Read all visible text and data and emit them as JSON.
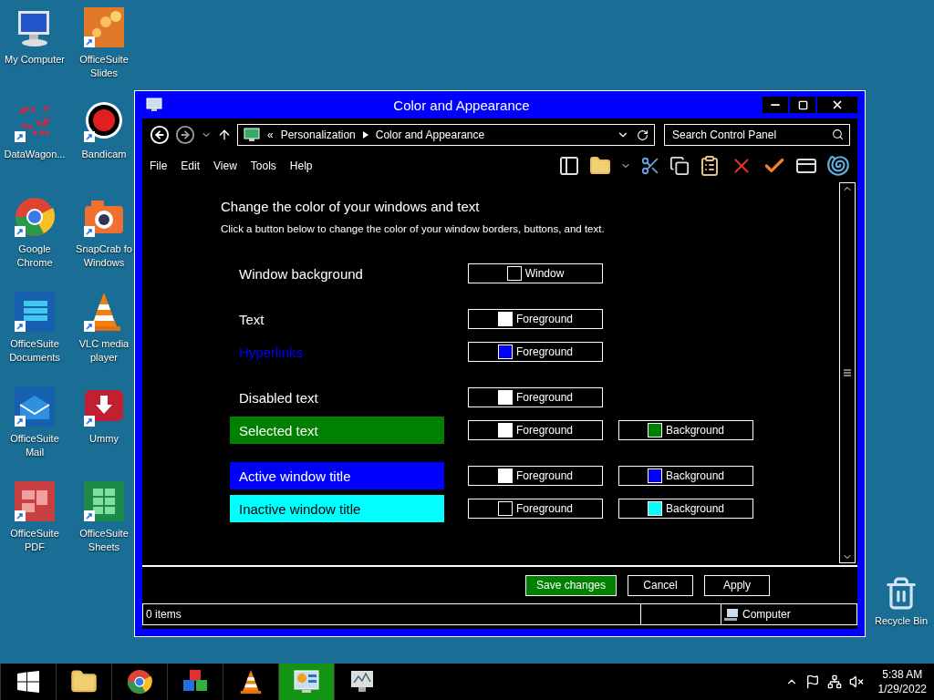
{
  "desktop_icons": [
    {
      "label": "My Computer",
      "kind": "computer",
      "shortcut": false
    },
    {
      "label": "OfficeSuite\nSlides",
      "kind": "slides",
      "shortcut": true
    },
    {
      "label": "DataWagon...",
      "kind": "network",
      "shortcut": true
    },
    {
      "label": "Bandicam",
      "kind": "record",
      "shortcut": true
    },
    {
      "label": "Google\nChrome",
      "kind": "chrome",
      "shortcut": true
    },
    {
      "label": "SnapCrab fo\nWindows",
      "kind": "camera",
      "shortcut": true
    },
    {
      "label": "OfficeSuite\nDocuments",
      "kind": "documents",
      "shortcut": true
    },
    {
      "label": "VLC media\nplayer",
      "kind": "cone",
      "shortcut": true
    },
    {
      "label": "OfficeSuite\nMail",
      "kind": "mail",
      "shortcut": true
    },
    {
      "label": "Ummy",
      "kind": "download",
      "shortcut": true
    },
    {
      "label": "OfficeSuite\nPDF",
      "kind": "pdf",
      "shortcut": true
    },
    {
      "label": "OfficeSuite\nSheets",
      "kind": "sheets",
      "shortcut": true
    }
  ],
  "recycle_bin": {
    "label": "Recycle Bin"
  },
  "window": {
    "title": "Color and Appearance",
    "breadcrumb": [
      "«",
      "Personalization",
      "Color and Appearance"
    ],
    "search": {
      "placeholder": "Search Control Panel"
    },
    "menu": [
      "File",
      "Edit",
      "View",
      "Tools",
      "Help"
    ],
    "heading": "Change the color of your windows and text",
    "subtitle": "Click a button below to change the color of your window borders, buttons, and text.",
    "groups": [
      [
        {
          "label": "Window background",
          "kind": "plain",
          "buttons": [
            {
              "label": "Window",
              "color": "#000000"
            }
          ]
        }
      ],
      [
        {
          "label": "Text",
          "kind": "plain",
          "buttons": [
            {
              "label": "Foreground",
              "color": "#ffffff"
            }
          ]
        },
        {
          "label": "Hyperlinks",
          "kind": "link",
          "color": "#0000ff",
          "buttons": [
            {
              "label": "Foreground",
              "color": "#0000ff"
            }
          ]
        }
      ],
      [
        {
          "label": "Disabled text",
          "kind": "plain",
          "buttons": [
            {
              "label": "Foreground",
              "color": "#ffffff"
            }
          ]
        },
        {
          "label": "Selected text",
          "kind": "band",
          "color": "#008000",
          "buttons": [
            {
              "label": "Foreground",
              "color": "#ffffff"
            },
            {
              "label": "Background",
              "color": "#008000"
            }
          ]
        }
      ],
      [
        {
          "label": "Active window title",
          "kind": "band",
          "color": "#0000ff",
          "buttons": [
            {
              "label": "Foreground",
              "color": "#ffffff"
            },
            {
              "label": "Background",
              "color": "#0000ff"
            }
          ]
        },
        {
          "label": "Inactive window title",
          "kind": "band",
          "color": "#00ffff",
          "buttons": [
            {
              "label": "Foreground",
              "color": "#000000"
            },
            {
              "label": "Background",
              "color": "#00ffff"
            }
          ]
        }
      ]
    ],
    "actions": [
      {
        "label": "Save changes",
        "primary": true
      },
      {
        "label": "Cancel",
        "primary": false
      },
      {
        "label": "Apply",
        "primary": false
      }
    ],
    "status_bar": {
      "items": "0 items",
      "location": "Computer"
    }
  },
  "taskbar": {
    "apps": [
      {
        "kind": "folder",
        "selected": false
      },
      {
        "kind": "chrome",
        "selected": false
      },
      {
        "kind": "cubes",
        "selected": false
      },
      {
        "kind": "cone",
        "selected": false
      },
      {
        "kind": "control-panel",
        "selected": true
      },
      {
        "kind": "monitor",
        "selected": false
      }
    ],
    "time": "5:38 AM",
    "date": "1/29/2022"
  }
}
